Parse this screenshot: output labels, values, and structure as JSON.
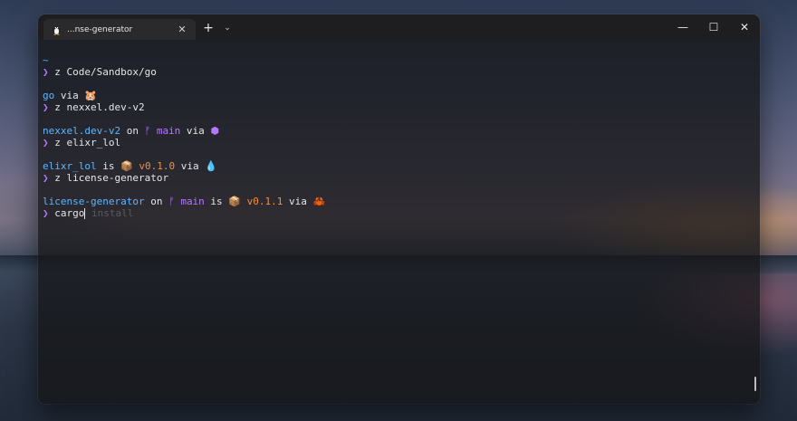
{
  "tab": {
    "title": "...nse-generator",
    "close": "✕"
  },
  "titlebar": {
    "new_tab": "+",
    "dropdown": "⌄",
    "minimize": "—",
    "maximize": "☐",
    "close": "✕"
  },
  "terminal": {
    "prompt_arrow": "❯",
    "home": "~",
    "cmd1": "z Code/Sandbox/go",
    "block2": {
      "dir": "go",
      "via": " via ",
      "icon": "🐹"
    },
    "cmd2": "z nexxel.dev-v2",
    "block3": {
      "dir": "nexxel.dev-v2",
      "on": " on ",
      "branch": "ᚠ main",
      "via": " via ",
      "icon": "⬢"
    },
    "cmd3": "z elixr_lol",
    "block4": {
      "dir": "elixr_lol",
      "is": " is ",
      "version": "📦 v0.1.0",
      "via": " via ",
      "icon": "💧"
    },
    "cmd4": "z license-generator",
    "block5": {
      "dir": "license-generator",
      "on": " on ",
      "branch": "ᚠ main",
      "is": " is ",
      "version": "📦 v0.1.1",
      "via": " via ",
      "icon": "🦀"
    },
    "current_input": "cargo",
    "suggestion": " install"
  }
}
